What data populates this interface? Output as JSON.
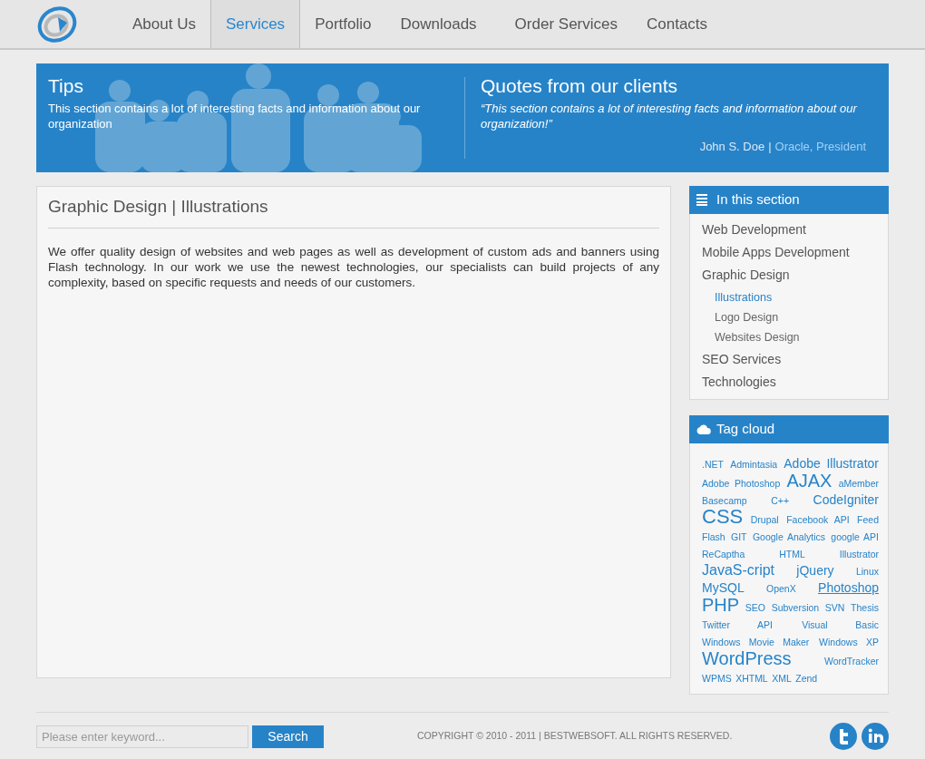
{
  "nav": {
    "items": [
      {
        "label": "About Us",
        "selected": false
      },
      {
        "label": "Services",
        "selected": true
      },
      {
        "label": "Portfolio",
        "selected": false
      },
      {
        "label": "Downloads",
        "selected": false
      },
      {
        "label": "Order Services",
        "selected": false
      },
      {
        "label": "Contacts",
        "selected": false
      }
    ]
  },
  "banner": {
    "tips": {
      "title": "Tips",
      "text": "This section contains a lot of interesting facts and information about our organization"
    },
    "quotes": {
      "title": "Quotes from our clients",
      "quote": "“This section contains a lot of interesting facts and information about our organization!”",
      "author": "John S. Doe",
      "separator": "|",
      "company": "Oracle, President"
    }
  },
  "content": {
    "title": "Graphic Design | Illustrations",
    "text": "We offer quality design of websites and web pages as well as development of custom ads and banners using Flash technology. In our work we use the newest technologies, our specialists can build projects of any complexity, based on specific requests and needs of our customers."
  },
  "section_menu": {
    "title": "In this section",
    "items": [
      {
        "label": "Web Development",
        "selected": false
      },
      {
        "label": "Mobile Apps Development",
        "selected": false
      },
      {
        "label": "Graphic Design",
        "selected": false,
        "children": [
          {
            "label": "Illustrations",
            "selected": true
          },
          {
            "label": "Logo Design",
            "selected": false
          },
          {
            "label": "Websites Design",
            "selected": false
          }
        ]
      },
      {
        "label": "SEO Services",
        "selected": false
      },
      {
        "label": "Technologies",
        "selected": false
      }
    ]
  },
  "tag_cloud": {
    "title": "Tag cloud",
    "tags": [
      {
        "label": ".NET",
        "kind": "small",
        "hovered": false
      },
      {
        "label": "Admintasia",
        "kind": "small",
        "hovered": false
      },
      {
        "label": "Adobe Illustrator",
        "kind": "medium",
        "hovered": false
      },
      {
        "label": "Adobe Photoshop",
        "kind": "small",
        "hovered": false
      },
      {
        "label": "AJAX",
        "kind": "large",
        "hovered": false
      },
      {
        "label": "aMember",
        "kind": "small",
        "hovered": false
      },
      {
        "label": "Basecamp",
        "kind": "small",
        "hovered": false
      },
      {
        "label": "C++",
        "kind": "small",
        "hovered": false
      },
      {
        "label": "CodeIgniter",
        "kind": "medium",
        "hovered": false
      },
      {
        "label": "CSS",
        "kind": "huge",
        "hovered": false
      },
      {
        "label": "Drupal",
        "kind": "small",
        "hovered": false
      },
      {
        "label": "Facebook API",
        "kind": "small",
        "hovered": false
      },
      {
        "label": "Feed",
        "kind": "small",
        "hovered": false
      },
      {
        "label": "Flash",
        "kind": "small",
        "hovered": false
      },
      {
        "label": "GIT",
        "kind": "small",
        "hovered": false
      },
      {
        "label": "Google Analytics",
        "kind": "small",
        "hovered": false
      },
      {
        "label": "google API",
        "kind": "small",
        "hovered": false
      },
      {
        "label": "ReCaptha",
        "kind": "small",
        "hovered": false
      },
      {
        "label": "HTML",
        "kind": "small",
        "hovered": false
      },
      {
        "label": "Illustrator",
        "kind": "small",
        "hovered": false
      },
      {
        "label": "JavaS-cript",
        "kind": "larger",
        "hovered": false
      },
      {
        "label": "jQuery",
        "kind": "medium",
        "hovered": false
      },
      {
        "label": "Linux",
        "kind": "small",
        "hovered": false
      },
      {
        "label": "MySQL",
        "kind": "medium",
        "hovered": false
      },
      {
        "label": "OpenX",
        "kind": "small",
        "hovered": false
      },
      {
        "label": "Photoshop",
        "kind": "medium",
        "hovered": true
      },
      {
        "label": "PHP",
        "kind": "large",
        "hovered": false
      },
      {
        "label": "SEO",
        "kind": "small",
        "hovered": false
      },
      {
        "label": "Subversion",
        "kind": "small",
        "hovered": false
      },
      {
        "label": "SVN",
        "kind": "small",
        "hovered": false
      },
      {
        "label": "Thesis",
        "kind": "small",
        "hovered": false
      },
      {
        "label": "Twitter API",
        "kind": "small",
        "hovered": false
      },
      {
        "label": "Visual Basic",
        "kind": "small",
        "hovered": false
      },
      {
        "label": "Windows Movie Maker",
        "kind": "small",
        "hovered": false
      },
      {
        "label": "Windows XP",
        "kind": "small",
        "hovered": false
      },
      {
        "label": "WordPress",
        "kind": "large",
        "hovered": false
      },
      {
        "label": "WordTracker",
        "kind": "small",
        "hovered": false
      },
      {
        "label": "WPMS",
        "kind": "small",
        "hovered": false
      },
      {
        "label": "XHTML",
        "kind": "small",
        "hovered": false
      },
      {
        "label": "XML",
        "kind": "small",
        "hovered": false
      },
      {
        "label": "Zend",
        "kind": "small",
        "hovered": false
      }
    ]
  },
  "footer": {
    "search": {
      "placeholder": "Please enter keyword...",
      "button": "Search"
    },
    "copyright": "COPYRIGHT © 2010 - 2011 | BESTWEBSOFT. ALL RIGHTS RESERVED."
  }
}
